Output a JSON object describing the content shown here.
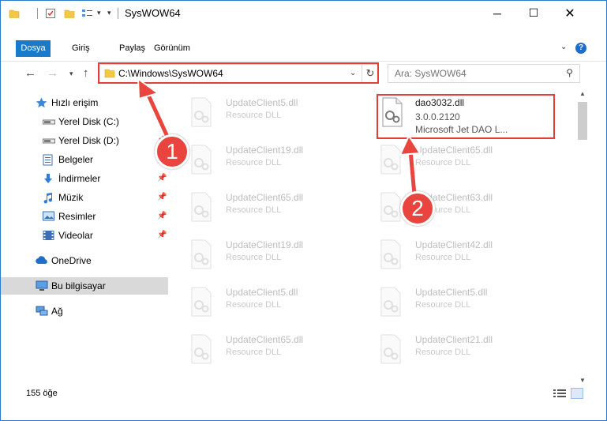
{
  "window": {
    "title": "SysWOW64",
    "minimize": "─",
    "maximize": "☐",
    "close": "✕"
  },
  "ribbon": {
    "tabs": [
      "Dosya",
      "Giriş",
      "Paylaş",
      "Görünüm"
    ],
    "help": "?"
  },
  "nav": {
    "address": "C:\\Windows\\SysWOW64",
    "search_placeholder": "Ara: SysWOW64"
  },
  "sidebar": {
    "items": [
      {
        "label": "Hızlı erişim",
        "icon": "star-icon",
        "pinned": false
      },
      {
        "label": "Yerel Disk (C:)",
        "icon": "drive-icon",
        "pinned": true
      },
      {
        "label": "Yerel Disk (D:)",
        "icon": "drive-icon",
        "pinned": true
      },
      {
        "label": "Belgeler",
        "icon": "documents-icon",
        "pinned": true
      },
      {
        "label": "İndirmeler",
        "icon": "download-icon",
        "pinned": true
      },
      {
        "label": "Müzik",
        "icon": "music-icon",
        "pinned": true
      },
      {
        "label": "Resimler",
        "icon": "pictures-icon",
        "pinned": true
      },
      {
        "label": "Videolar",
        "icon": "videos-icon",
        "pinned": true
      },
      {
        "label": "OneDrive",
        "icon": "onedrive-icon",
        "pinned": false
      },
      {
        "label": "Bu bilgisayar",
        "icon": "computer-icon",
        "pinned": false
      },
      {
        "label": "Ağ",
        "icon": "network-icon",
        "pinned": false
      }
    ]
  },
  "files": {
    "highlighted": {
      "name": "dao3032.dll",
      "version": "3.0.0.2120",
      "description": "Microsoft Jet DAO L..."
    },
    "left_column": [
      {
        "name": "UpdateClient5.dll",
        "desc": "Resource DLL"
      },
      {
        "name": "UpdateClient19.dll",
        "desc": "Resource DLL"
      },
      {
        "name": "UpdateClient65.dll",
        "desc": "Resource DLL"
      },
      {
        "name": "UpdateClient19.dll",
        "desc": "Resource DLL"
      },
      {
        "name": "UpdateClient5.dll",
        "desc": "Resource DLL"
      },
      {
        "name": "UpdateClient65.dll",
        "desc": "Resource DLL"
      }
    ],
    "right_column": [
      {
        "name": "UpdateClient65.dll",
        "desc": "Resource DLL"
      },
      {
        "name": "UpdateClient63.dll",
        "desc": "Resource DLL"
      },
      {
        "name": "UpdateClient42.dll",
        "desc": "Resource DLL"
      },
      {
        "name": "UpdateClient5.dll",
        "desc": "Resource DLL"
      },
      {
        "name": "UpdateClient21.dll",
        "desc": "Resource DLL"
      }
    ]
  },
  "status": {
    "item_count": "155 öğe"
  },
  "markers": [
    "1",
    "2"
  ],
  "colors": {
    "accent": "#1979ca",
    "highlight": "#e0403a"
  }
}
